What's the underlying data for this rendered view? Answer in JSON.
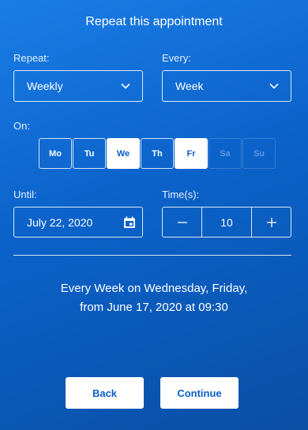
{
  "title": "Repeat this appointment",
  "repeat": {
    "label": "Repeat:",
    "value": "Weekly"
  },
  "every": {
    "label": "Every:",
    "value": "Week"
  },
  "on": {
    "label": "On:",
    "days": [
      {
        "label": "Mo",
        "state": "unselected"
      },
      {
        "label": "Tu",
        "state": "unselected"
      },
      {
        "label": "We",
        "state": "selected"
      },
      {
        "label": "Th",
        "state": "unselected"
      },
      {
        "label": "Fr",
        "state": "selected"
      },
      {
        "label": "Sa",
        "state": "disabled"
      },
      {
        "label": "Su",
        "state": "disabled"
      }
    ]
  },
  "until": {
    "label": "Until:",
    "value": "July 22, 2020"
  },
  "times": {
    "label": "Time(s):",
    "value": "10",
    "decrement_icon": "minus-icon",
    "increment_icon": "plus-icon"
  },
  "summary": {
    "line1": "Every Week on Wednesday, Friday,",
    "line2": "from June 17, 2020 at 09:30"
  },
  "buttons": {
    "back": "Back",
    "continue": "Continue"
  },
  "colors": {
    "accent": "#0c5fc4",
    "background_top": "#1a7de6",
    "background_bottom": "#0a4fa6"
  }
}
